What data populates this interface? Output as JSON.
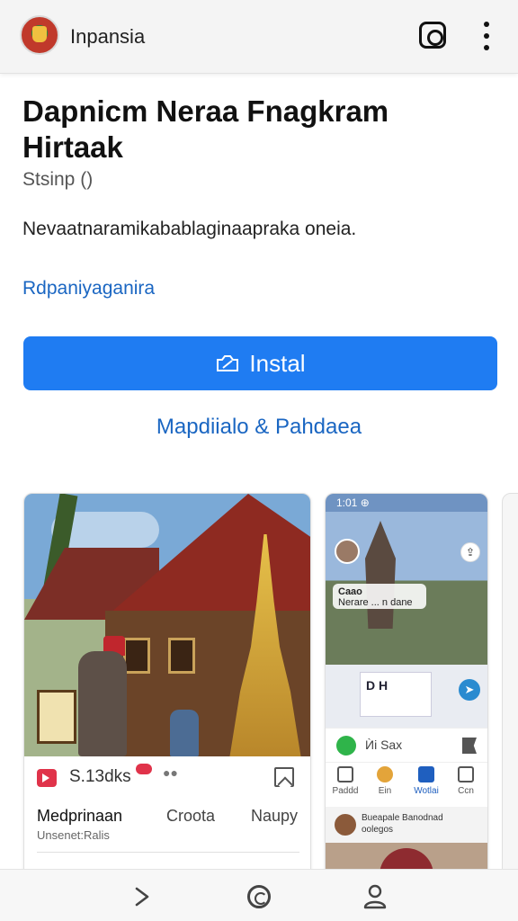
{
  "header": {
    "brand": "Inpansia",
    "icons": [
      "app-logo",
      "instagram-icon",
      "more-vert-icon"
    ]
  },
  "app": {
    "title": "Dapnicm Neraa Fnagkram Hirtaak",
    "subtitle": "Stsinp ()",
    "description": "Nevaatnaramikabablaginaapraka oneia.",
    "link": "Rdpaniyaganira",
    "install_label": "Instal",
    "secondary_link": "Mapdiialo & Pahdaea"
  },
  "card1": {
    "stat": "S.13dks",
    "labels": [
      "Medprinaan",
      "Croota",
      "Naupy"
    ],
    "caption": "Unsenet:Ralis"
  },
  "card2": {
    "status": "1:01 ⊕",
    "chip_title": "Caao",
    "chip_text": "Nerare ... n dane",
    "mid_letters": "D  H",
    "actions_text": "Ѝi  Sax",
    "tabs": [
      "Paddd",
      "Ein",
      "Wotlai",
      "Ccn"
    ],
    "news_title": "Bueapale Banodnad",
    "news_sub": "oolegos"
  },
  "colors": {
    "install_button": "#1f7cf2",
    "link": "#1a66c2",
    "accent_red": "#e0334a"
  }
}
